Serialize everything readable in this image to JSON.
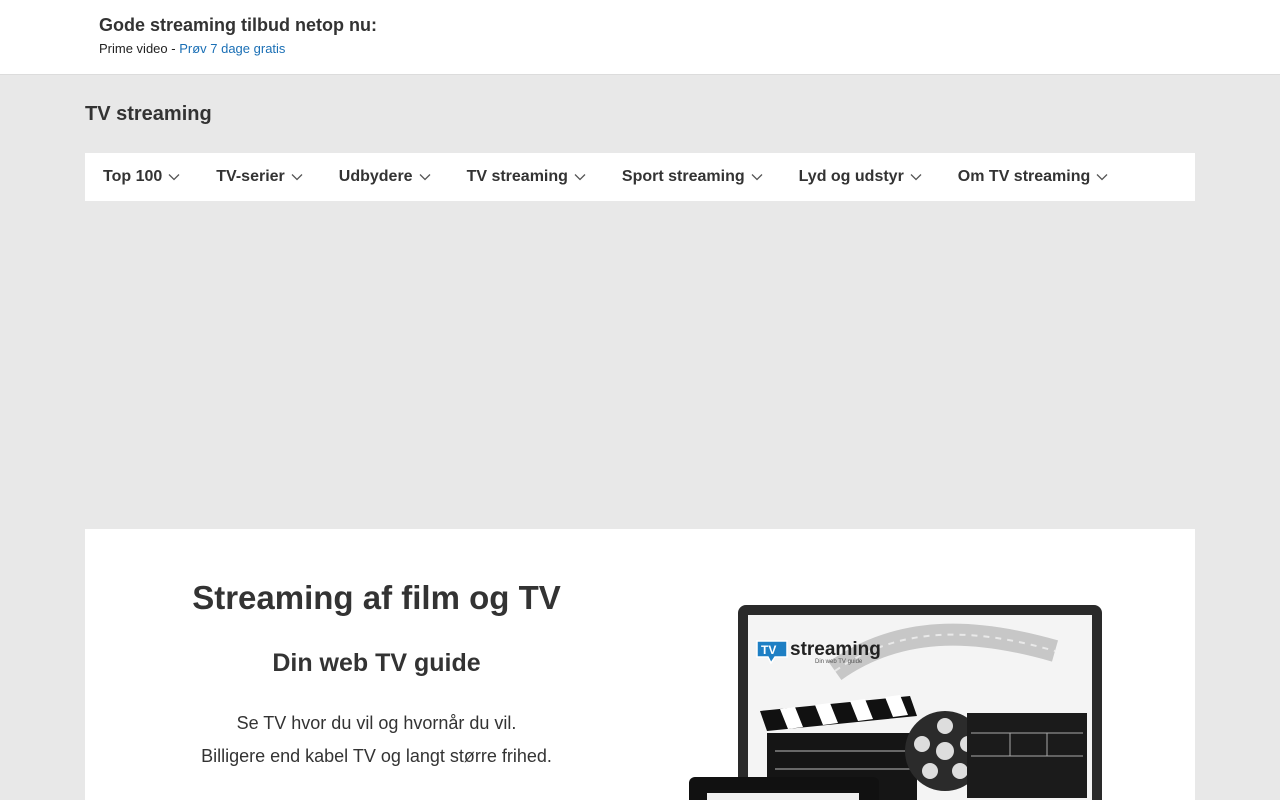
{
  "topbar": {
    "title": "Gode streaming tilbud netop nu:",
    "prefix": "Prime video - ",
    "link": "Prøv 7 dage gratis"
  },
  "site": {
    "title": "TV streaming"
  },
  "nav": {
    "items": [
      {
        "label": "Top 100"
      },
      {
        "label": "TV-serier"
      },
      {
        "label": "Udbydere"
      },
      {
        "label": "TV streaming"
      },
      {
        "label": "Sport streaming"
      },
      {
        "label": "Lyd og udstyr"
      },
      {
        "label": "Om TV streaming"
      }
    ]
  },
  "hero": {
    "title": "Streaming af film og TV",
    "subtitle": "Din web TV guide",
    "line1": "Se TV hvor du vil og hvornår du vil.",
    "line2": "Billigere end kabel TV og langt større frihed.",
    "logo_tv": "TV",
    "logo_text": "streaming",
    "logo_tagline": "Din web TV guide"
  },
  "colors": {
    "link": "#1a6fb5",
    "page_bg": "#e8e8e8",
    "logo_blue": "#1e7fc4"
  }
}
